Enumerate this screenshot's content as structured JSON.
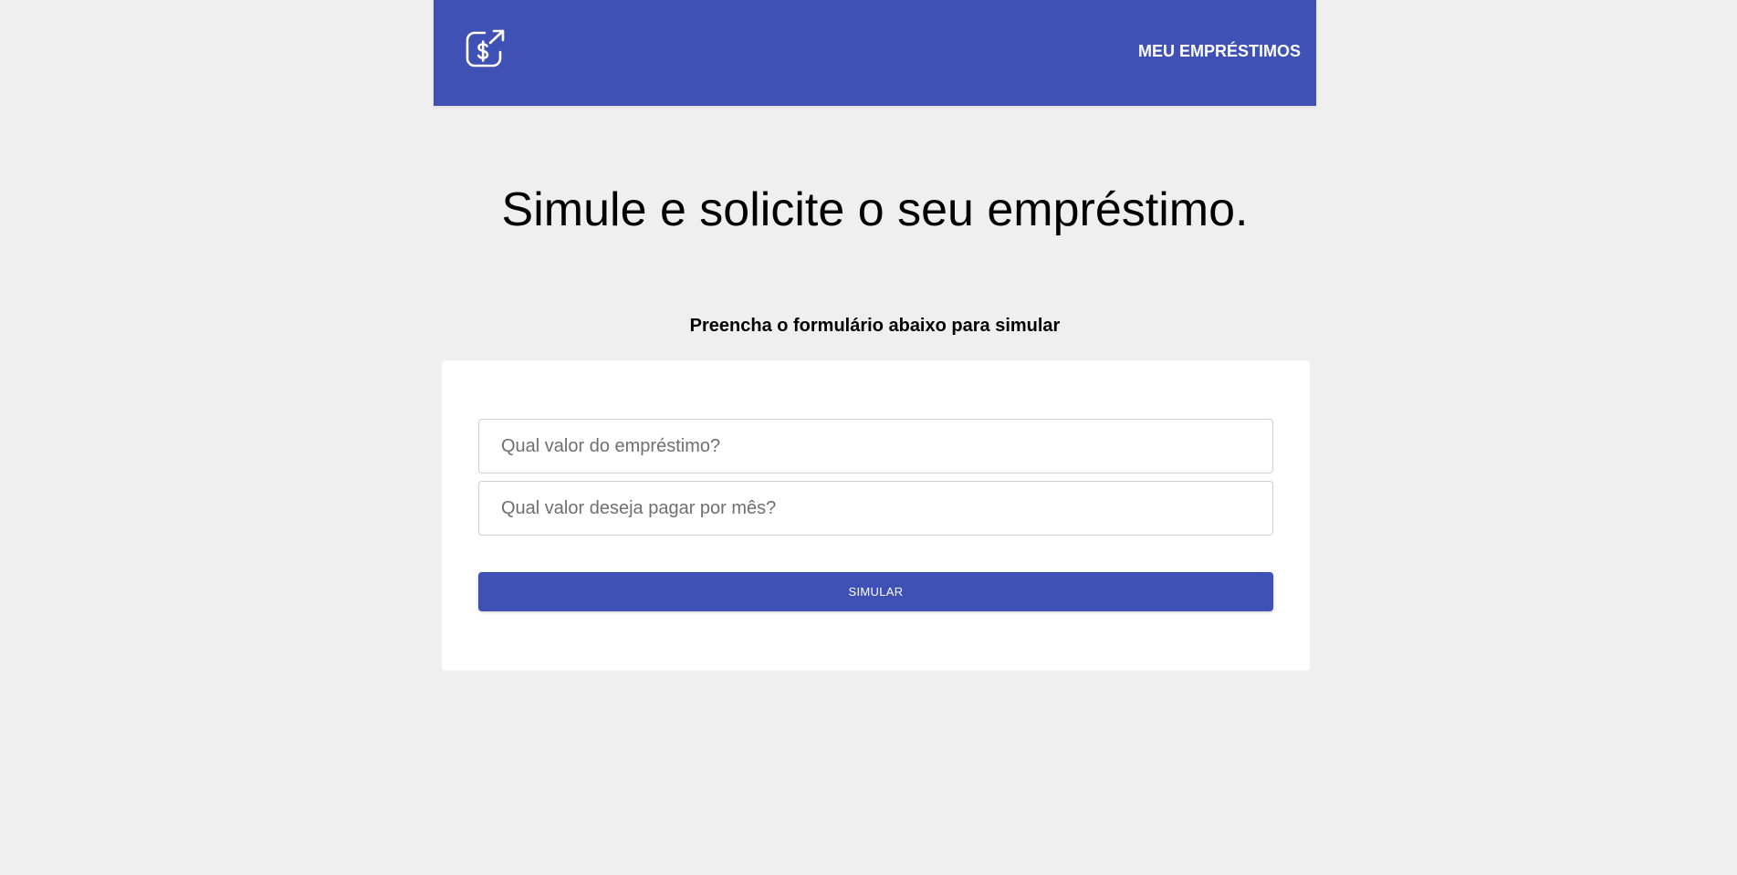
{
  "header": {
    "logo_icon": "dollar-transfer-icon",
    "nav_label": "MEU EMPRÉSTIMOS",
    "background_color": "#3f51b5"
  },
  "main": {
    "title": "Simule e solicite o seu empréstimo.",
    "subtitle": "Preencha o formulário abaixo para simular"
  },
  "form": {
    "loan_amount": {
      "value": "",
      "placeholder": "Qual valor do empréstimo?"
    },
    "monthly_payment": {
      "value": "",
      "placeholder": "Qual valor deseja pagar por mês?"
    },
    "submit_label": "SIMULAR"
  },
  "colors": {
    "accent": "#3f51b5",
    "page_background": "#efefef",
    "card_background": "#ffffff"
  }
}
